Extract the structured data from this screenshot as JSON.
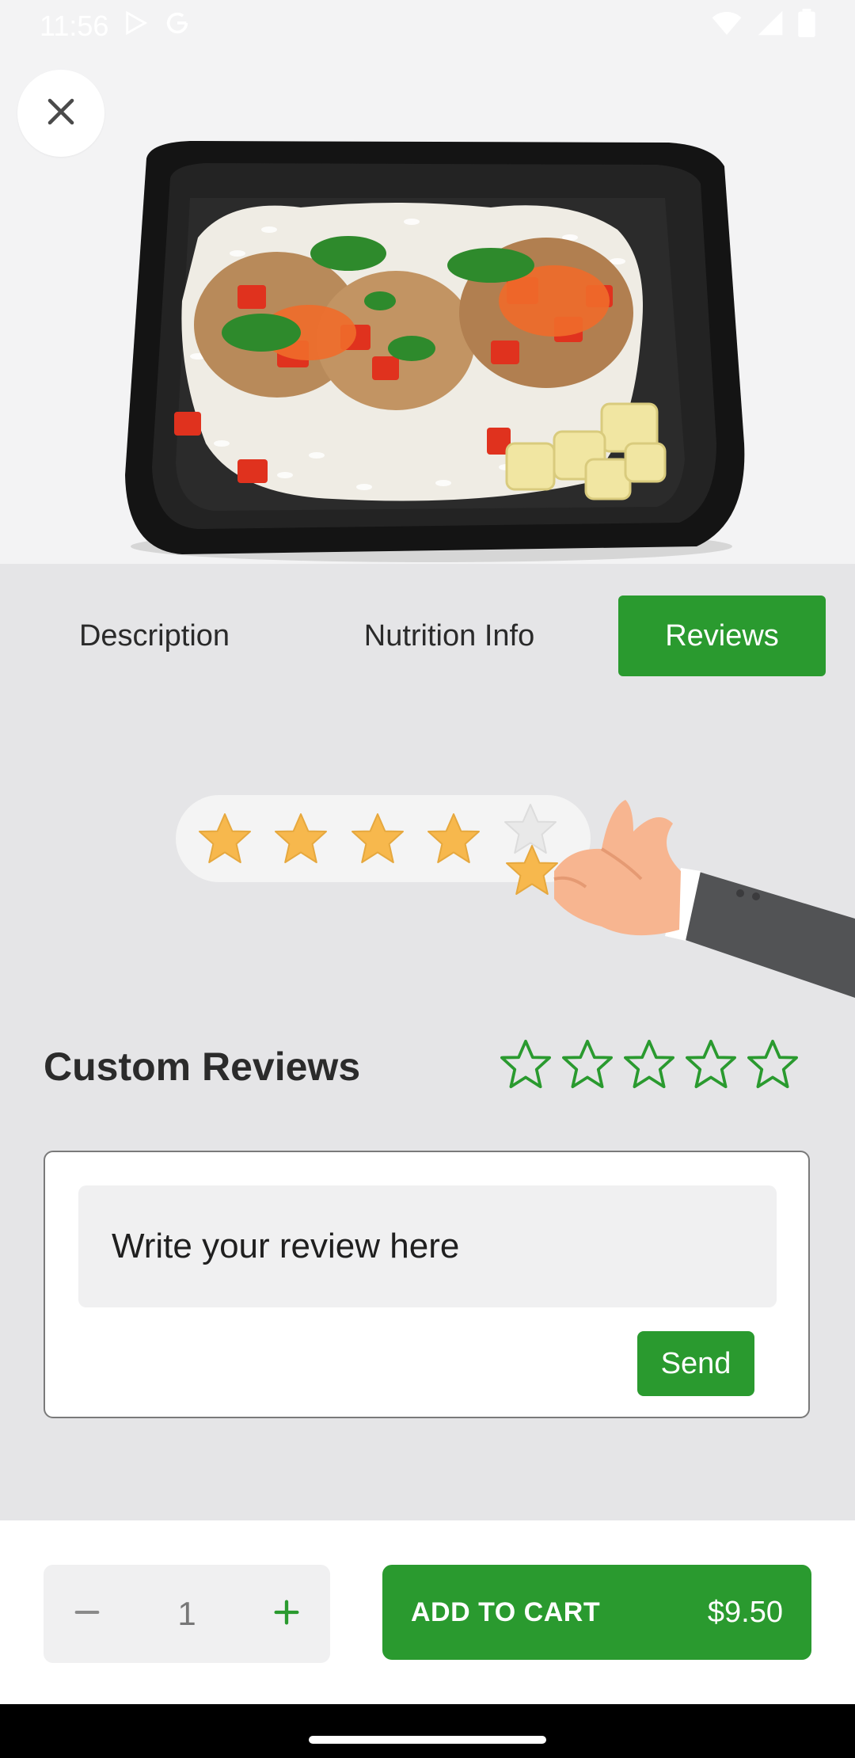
{
  "status_bar": {
    "time": "11:56",
    "icons": [
      "play-store-icon",
      "google-icon",
      "wifi-icon",
      "signal-icon",
      "battery-icon"
    ]
  },
  "hero": {
    "image_alt": "Meal container with rice, meatballs, tomato salsa and pineapple"
  },
  "tabs": [
    {
      "label": "Description",
      "active": false
    },
    {
      "label": "Nutrition Info",
      "active": false
    },
    {
      "label": "Reviews",
      "active": true
    }
  ],
  "reviews": {
    "section_title": "Custom Reviews",
    "illustration_rating": 4,
    "user_rating": 0,
    "star_count": 5,
    "review_placeholder": "Write your review here",
    "send_label": "Send"
  },
  "cart": {
    "quantity": "1",
    "add_label": "ADD TO CART",
    "price": "$9.50"
  },
  "colors": {
    "accent": "#2a9a2f",
    "background": "#e5e5e7",
    "star_gold": "#f7b84d"
  }
}
